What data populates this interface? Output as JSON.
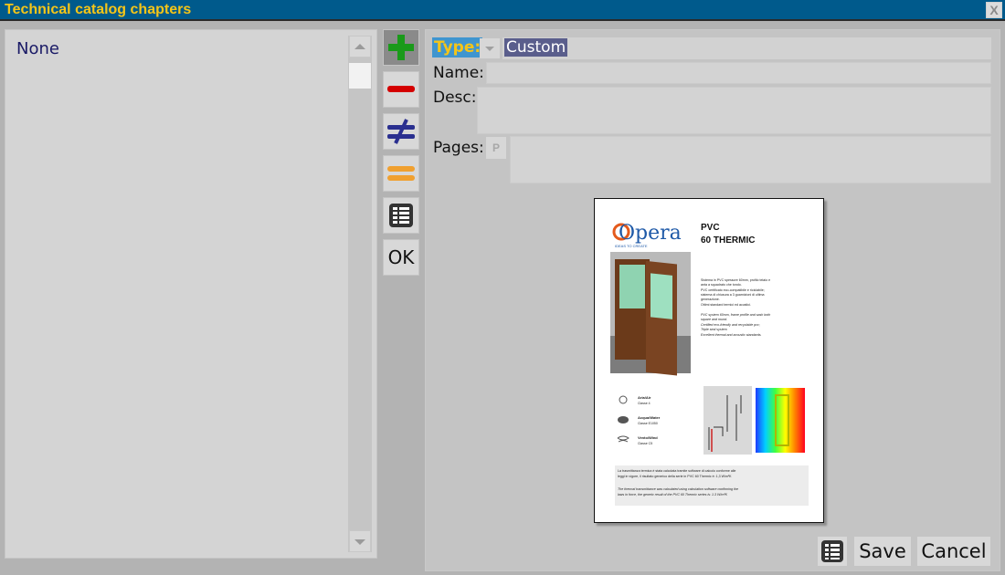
{
  "window": {
    "title": "Technical catalog chapters",
    "close_label": "X"
  },
  "list": {
    "items": [
      "None"
    ]
  },
  "toolbar": {
    "add_icon": "plus-icon",
    "remove_icon": "minus-icon",
    "not_equal_icon": "not-equal-icon",
    "equal_icon": "equals-icon",
    "table_icon": "table-icon",
    "ok_label": "OK"
  },
  "form": {
    "type_label": "Type:",
    "type_value": "Custom",
    "name_label": "Name:",
    "name_value": "",
    "desc_label": "Desc:",
    "desc_value": "",
    "pages_label": "Pages:",
    "pages_button_label": "P",
    "pages_value": ""
  },
  "preview": {
    "brand": "Opera",
    "brand_tagline": "IDEAS TO CREATE",
    "product_line1": "PVC",
    "product_line2": "60 THERMIC",
    "desc_it": [
      "Sistema in PVC spessore 60mm, profilo telaio e",
      "anta a squadrato che tondo.",
      "PVC certificato eco-compatibile e riciclabile;",
      "sistema di chiusura a 3 guarnizioni di ultima",
      "generazione.",
      "Ottimi standard termici ed acustici."
    ],
    "desc_en": [
      "PVC system 60mm, frame profile and sash both",
      "square and round.",
      "Certified eco-friendly and recyclable pvc;",
      "Triple seal system",
      "Excellent thermal and acoustic standards."
    ],
    "ratings": [
      {
        "icon": "air-icon",
        "title": "Aria/Air",
        "class": "Classe 4"
      },
      {
        "icon": "water-icon",
        "title": "Acqua/Water",
        "class": "Classe E1050"
      },
      {
        "icon": "wind-icon",
        "title": "Vento/Wind",
        "class": "Classe C5"
      }
    ],
    "footer_it": [
      "La trasmittanza termica è stata calcolata tramite software di calcolo conforme alle",
      "leggi in vigore, il risultato generico della serie in PVC 60 Thermic è: 1,3 W/m²K"
    ],
    "footer_en": [
      "The thermal transmittance was calculated using calculation software confirming the",
      "laws in force, the generic result of the PVC 60 Thermic series is: 1.3 W/m²K"
    ]
  },
  "actions": {
    "table_icon": "table-icon",
    "save_label": "Save",
    "cancel_label": "Cancel"
  },
  "colors": {
    "title_bar": "#005a8c",
    "title_text": "#f5c518",
    "type_highlight": "#3f95cf",
    "selection": "#5a5e8c",
    "add": "#1a9a1a",
    "remove": "#d40000",
    "not_equal": "#2a2f8f",
    "equal": "#f0a030"
  }
}
